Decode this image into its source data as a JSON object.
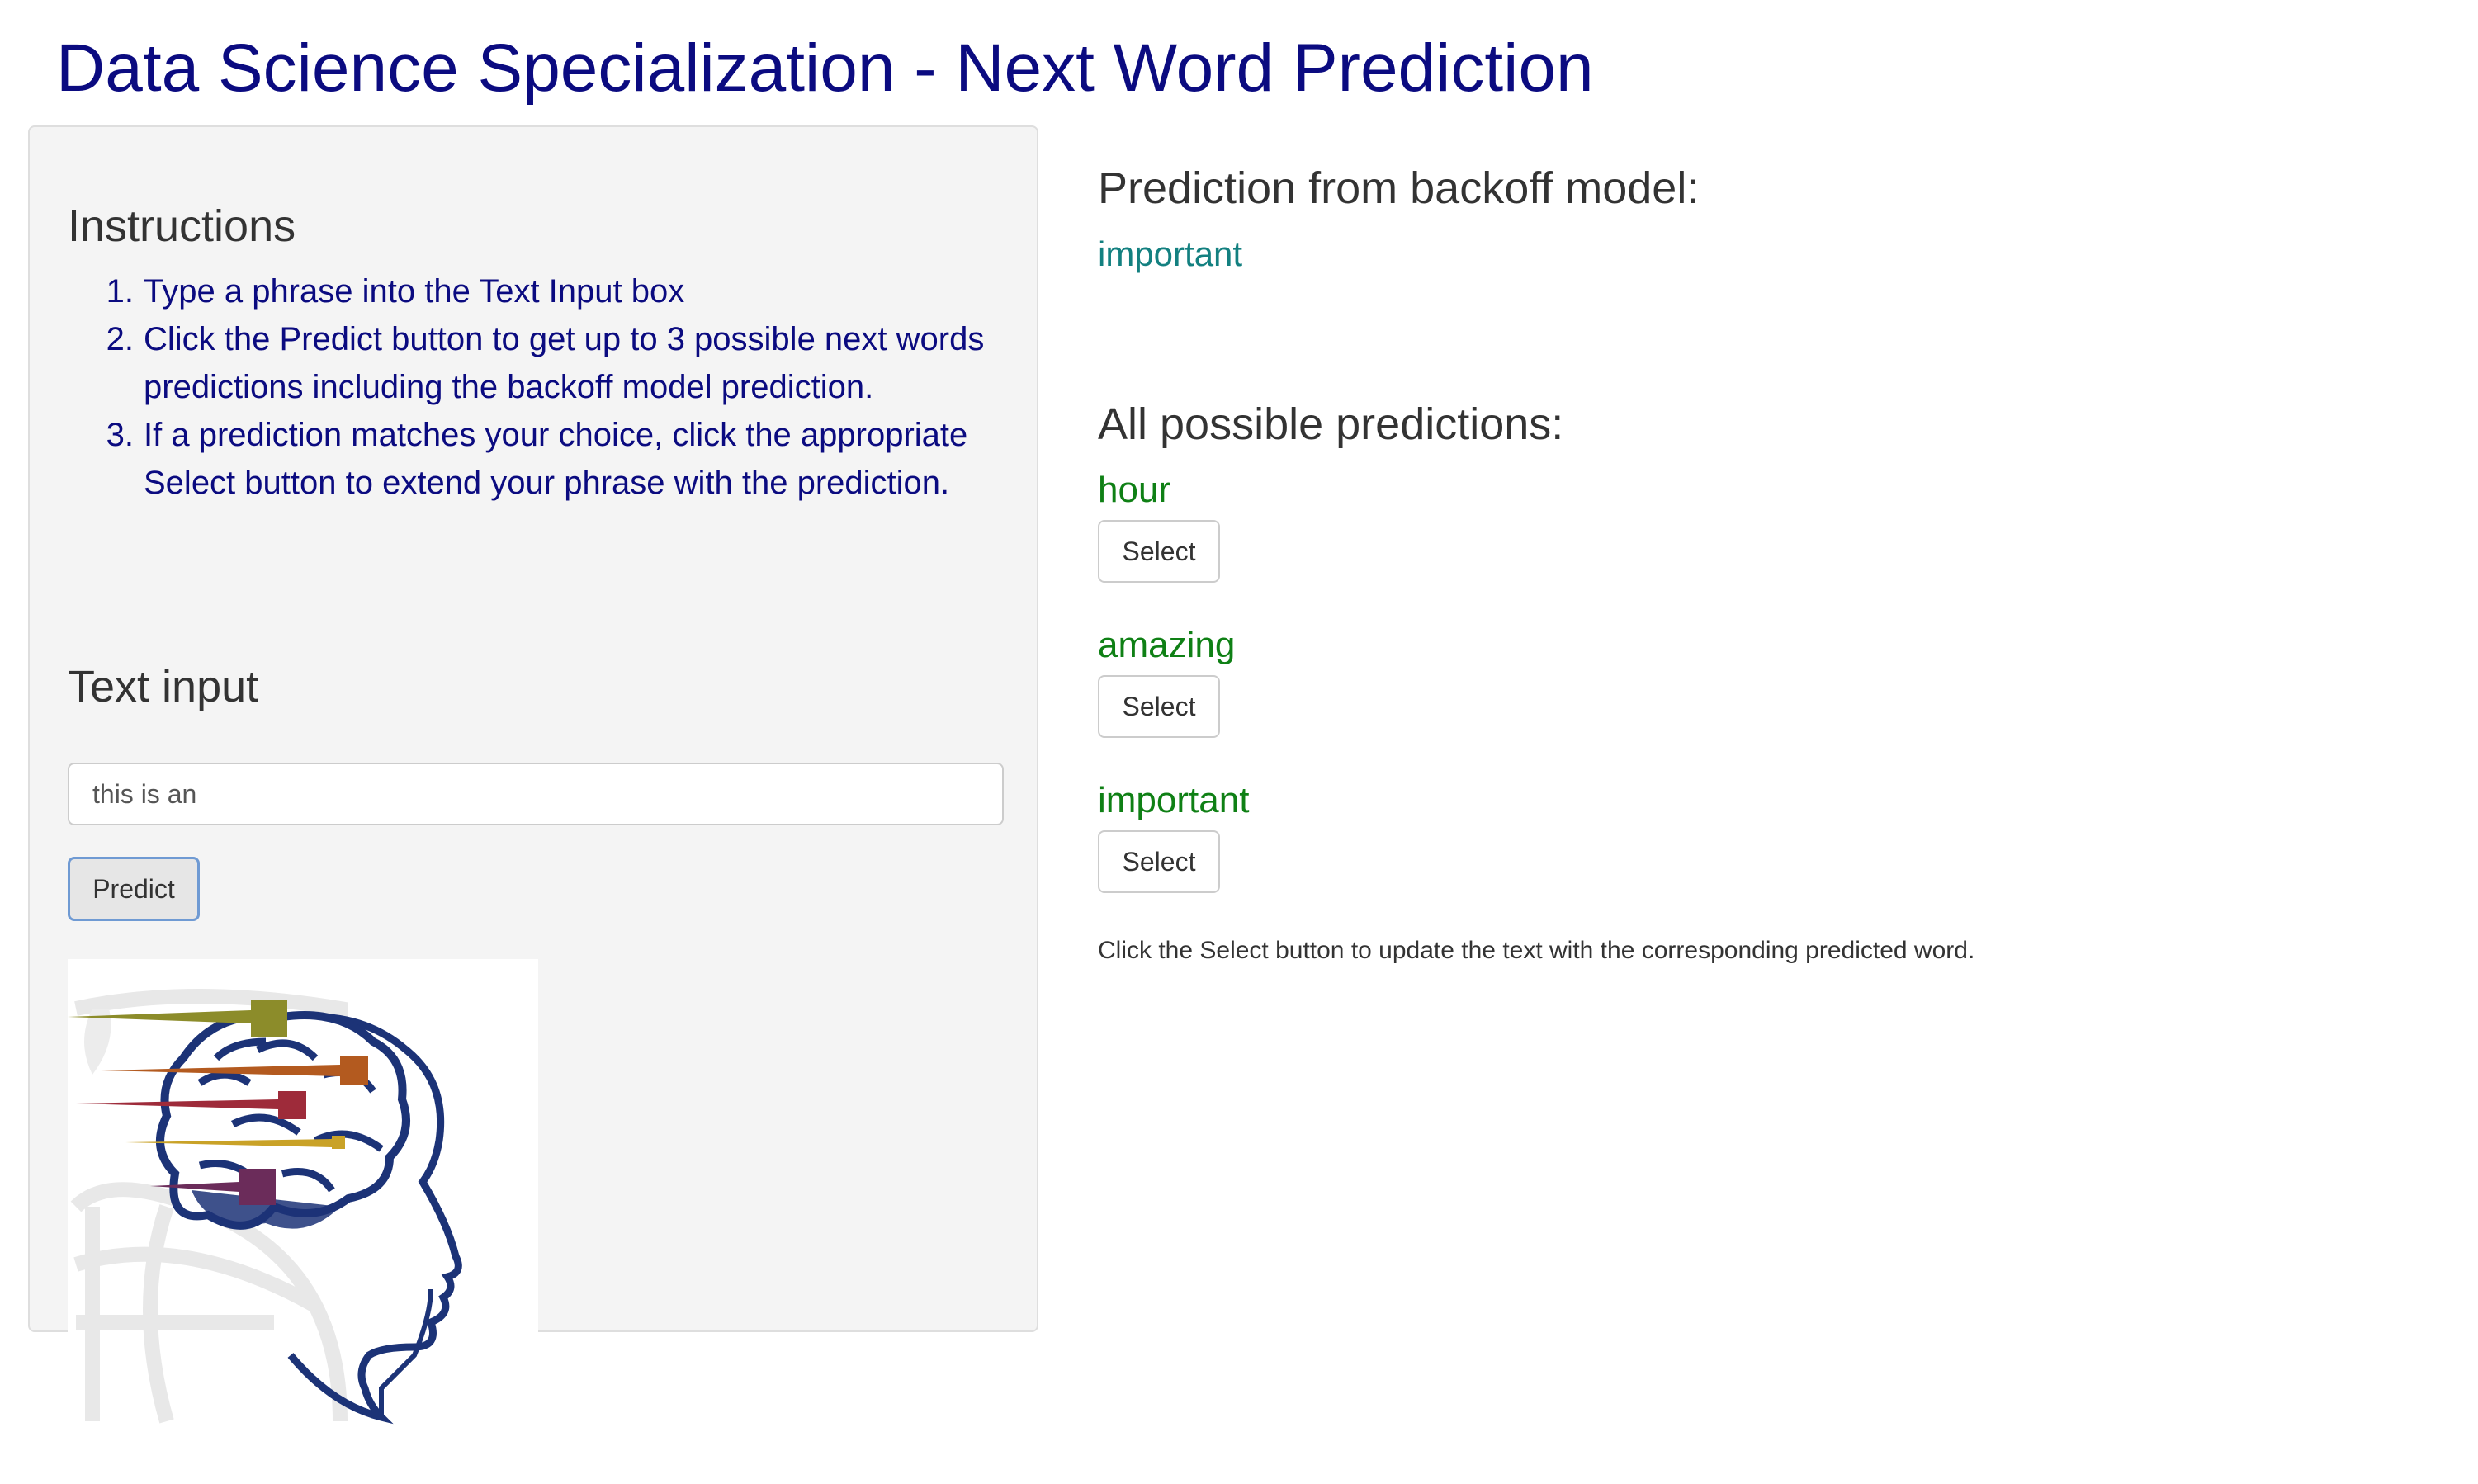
{
  "title": "Data Science Specialization - Next Word Prediction",
  "sidebar": {
    "instructions_heading": "Instructions",
    "instructions": [
      {
        "num": "1.",
        "text": "Type a phrase into the Text Input box"
      },
      {
        "num": "2.",
        "text": "Click the Predict button to get up to 3 possible next words predictions including the backoff model prediction."
      },
      {
        "num": "3.",
        "text": "If a prediction matches your choice, click the appropriate Select button to extend your phrase with the prediction."
      }
    ],
    "text_input_heading": "Text input",
    "text_input_value": "this is an",
    "predict_label": "Predict"
  },
  "main": {
    "backoff_heading": "Prediction from backoff model:",
    "backoff_prediction": "important",
    "all_heading": "All possible predictions:",
    "predictions": [
      {
        "word": "hour",
        "select_label": "Select"
      },
      {
        "word": "amazing",
        "select_label": "Select"
      },
      {
        "word": "important",
        "select_label": "Select"
      }
    ],
    "help_text": "Click the Select button to update the text with the corresponding predicted word."
  },
  "colors": {
    "title": "#0b0b80",
    "instructions": "#0b0b80",
    "backoff_word": "#138080",
    "prediction_word": "#0f8015",
    "sidebar_bg": "#f4f4f4"
  },
  "icons": {
    "brain": "brain-head-illustration"
  }
}
